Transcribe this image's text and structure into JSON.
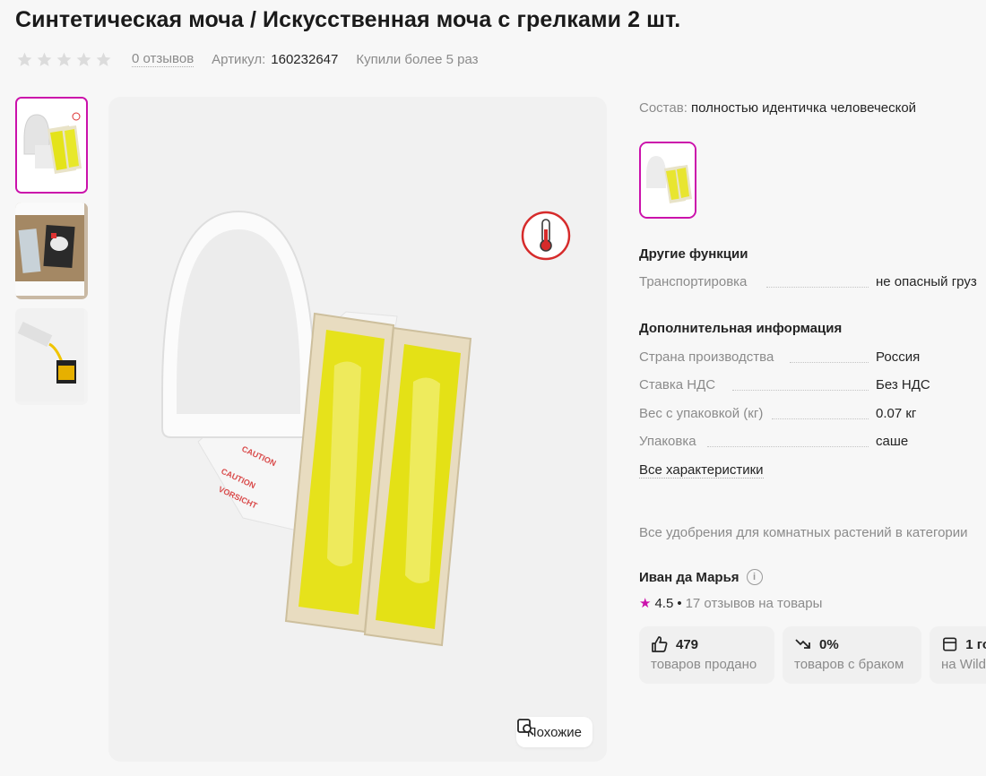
{
  "product": {
    "title": "Синтетическая моча / Искусственная моча с грелками 2 шт.",
    "reviews_link": "0 отзывов",
    "article_label": "Артикул:",
    "article_value": "160232647",
    "bought": "Купили более 5 раз",
    "rating_stars": 0,
    "similar_button": "Похожие"
  },
  "composition": {
    "label": "Состав:",
    "value": "полностью идентичка человеческой"
  },
  "other_functions": {
    "title": "Другие функции",
    "rows": [
      {
        "key": "Транспортировка",
        "value": "не опасный груз"
      }
    ]
  },
  "additional_info": {
    "title": "Дополнительная информация",
    "rows": [
      {
        "key": "Страна производства",
        "value": "Россия"
      },
      {
        "key": "Ставка НДС",
        "value": "Без НДС"
      },
      {
        "key": "Вес с упаковкой (кг)",
        "value": "0.07 кг"
      },
      {
        "key": "Упаковка",
        "value": "саше"
      }
    ],
    "all_chars_link": "Все характеристики"
  },
  "category_line": "Все удобрения для комнатных растений в категории",
  "seller": {
    "name": "Иван да Марья",
    "info_icon": "i",
    "rating": "4.5",
    "separator": "•",
    "reviews": "17 отзывов на товары"
  },
  "stats": [
    {
      "icon": "thumbs-up-icon",
      "value": "479",
      "label": "товаров продано"
    },
    {
      "icon": "trend-down-icon",
      "value": "0%",
      "label": "товаров с браком"
    },
    {
      "icon": "store-icon",
      "value": "1 го",
      "label": "на Wild"
    }
  ],
  "colors": {
    "accent": "#cb11ab",
    "text": "#242424",
    "muted": "#8b8b8b"
  }
}
